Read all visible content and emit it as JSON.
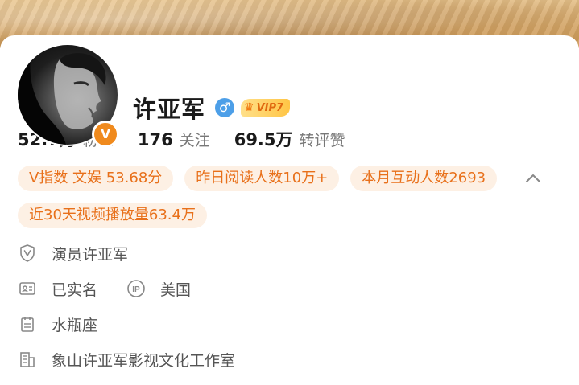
{
  "profile": {
    "name": "许亚军",
    "gender_symbol": "♂",
    "vip_label": "VIP7",
    "verified_badge": "V"
  },
  "stats": [
    {
      "value": "52.7万",
      "label": "粉丝"
    },
    {
      "value": "176",
      "label": "关注"
    },
    {
      "value": "69.5万",
      "label": "转评赞"
    }
  ],
  "tags": {
    "row1": [
      "V指数 文娱 53.68分",
      "昨日阅读人数10万+",
      "本月互动人数2693"
    ],
    "row2": [
      "近30天视频播放量63.4万"
    ]
  },
  "info": {
    "verification": "演员许亚军",
    "real_name": "已实名",
    "ip_location": "美国",
    "zodiac": "水瓶座",
    "company": "象山许亚军影视文化工作室"
  },
  "icons": {
    "verification": "shield-v-icon",
    "real_name": "id-card-icon",
    "ip": "ip-icon",
    "zodiac": "calendar-icon",
    "company": "building-icon",
    "expand": "chevron-up-icon"
  },
  "colors": {
    "accent": "#e8701a",
    "tag_bg": "#fdf0e4",
    "gender": "#4d9fe8",
    "verified": "#f08a1d"
  }
}
